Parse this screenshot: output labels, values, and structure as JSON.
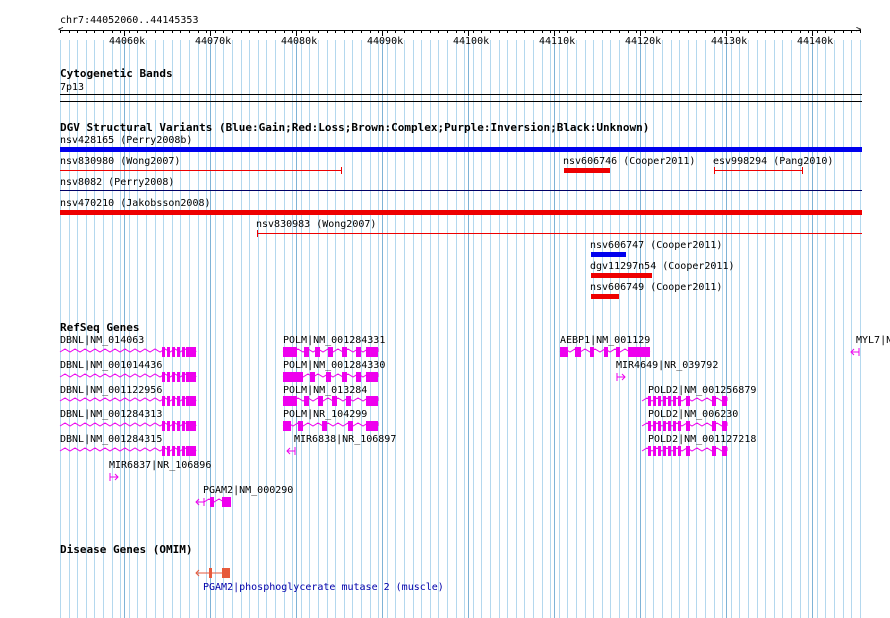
{
  "ruler": {
    "position": "chr7:44052060..44145353",
    "ticks": [
      "44060k",
      "44070k",
      "44080k",
      "44090k",
      "44100k",
      "44110k",
      "44120k",
      "44130k",
      "44140k"
    ]
  },
  "cytoband": {
    "title": "Cytogenetic Bands",
    "band": "7p13"
  },
  "dgv": {
    "title": "DGV Structural Variants (Blue:Gain;Red:Loss;Brown:Complex;Purple:Inversion;Black:Unknown)",
    "variants": [
      {
        "label": "nsv428165 (Perry2008b)",
        "color": "#0000ee"
      },
      {
        "label": "nsv830980 (Wong2007)",
        "color": "#ee0000"
      },
      {
        "label": "nsv606746 (Cooper2011)",
        "color": "#ee0000"
      },
      {
        "label": "esv998294 (Pang2010)",
        "color": "#ee0000"
      },
      {
        "label": "nsv8082 (Perry2008)",
        "color": "#000066"
      },
      {
        "label": "nsv470210 (Jakobsson2008)",
        "color": "#ee0000"
      },
      {
        "label": "nsv830983 (Wong2007)",
        "color": "#ee0000"
      },
      {
        "label": "nsv606747 (Cooper2011)",
        "color": "#0000ee"
      },
      {
        "label": "dgv11297n54 (Cooper2011)",
        "color": "#ee0000"
      },
      {
        "label": "nsv606749 (Cooper2011)",
        "color": "#ee0000"
      }
    ]
  },
  "refseq": {
    "title": "RefSeq Genes",
    "genes": [
      {
        "label": "DBNL|NM_014063"
      },
      {
        "label": "DBNL|NM_001014436"
      },
      {
        "label": "DBNL|NM_001122956"
      },
      {
        "label": "DBNL|NM_001284313"
      },
      {
        "label": "DBNL|NM_001284315"
      },
      {
        "label": "MIR6837|NR_106896"
      },
      {
        "label": "PGAM2|NM_000290"
      },
      {
        "label": "POLM|NM_001284331"
      },
      {
        "label": "POLM|NM_001284330"
      },
      {
        "label": "POLM|NM_013284"
      },
      {
        "label": "POLM|NR_104299"
      },
      {
        "label": "MIR6838|NR_106897"
      },
      {
        "label": "AEBP1|NM_001129"
      },
      {
        "label": "MIR4649|NR_039792"
      },
      {
        "label": "POLD2|NM_001256879"
      },
      {
        "label": "POLD2|NM_006230"
      },
      {
        "label": "POLD2|NM_001127218"
      },
      {
        "label": "MYL7|N"
      }
    ]
  },
  "disease": {
    "title": "Disease Genes (OMIM)",
    "gene": {
      "label": "PGAM2|phosphoglycerate mutase 2 (muscle)",
      "color": "#e65a3c"
    }
  },
  "colors": {
    "gridline": "#b4d8ee",
    "gene": "#ee00ee",
    "link": "#0000aa"
  }
}
